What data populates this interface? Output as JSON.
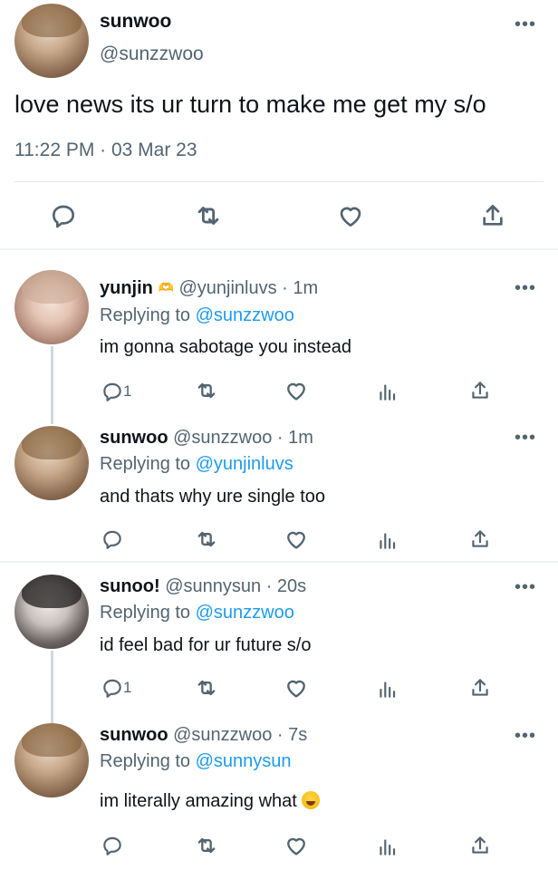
{
  "main_tweet": {
    "name": "sunwoo",
    "handle": "@sunzzwoo",
    "text": "love news its ur turn to make me get my s/o",
    "timestamp": "11:22 PM · 03 Mar 23",
    "more": "•••"
  },
  "replies": [
    {
      "name": "yunjin",
      "name_emoji": "🫶",
      "handle": "@yunjinluvs",
      "time": "1m",
      "replying_label": "Replying to",
      "replying_to": "@sunzzwoo",
      "text": "im gonna sabotage you instead",
      "reply_count": "1",
      "more": "•••"
    },
    {
      "name": "sunwoo",
      "handle": "@sunzzwoo",
      "time": "1m",
      "replying_label": "Replying to",
      "replying_to": "@yunjinluvs",
      "text": "and thats why ure single too",
      "reply_count": "",
      "more": "•••"
    },
    {
      "name": "sunoo!",
      "handle": "@sunnysun",
      "time": "20s",
      "replying_label": "Replying to",
      "replying_to": "@sunzzwoo",
      "text": "id feel bad for ur future s/o",
      "reply_count": "1",
      "more": "•••"
    },
    {
      "name": "sunwoo",
      "handle": "@sunzzwoo",
      "time": "7s",
      "replying_label": "Replying to",
      "replying_to": "@sunnysun",
      "text": "im literally amazing what",
      "text_emoji": "😂",
      "reply_count": "",
      "more": "•••"
    }
  ],
  "separator": " · "
}
